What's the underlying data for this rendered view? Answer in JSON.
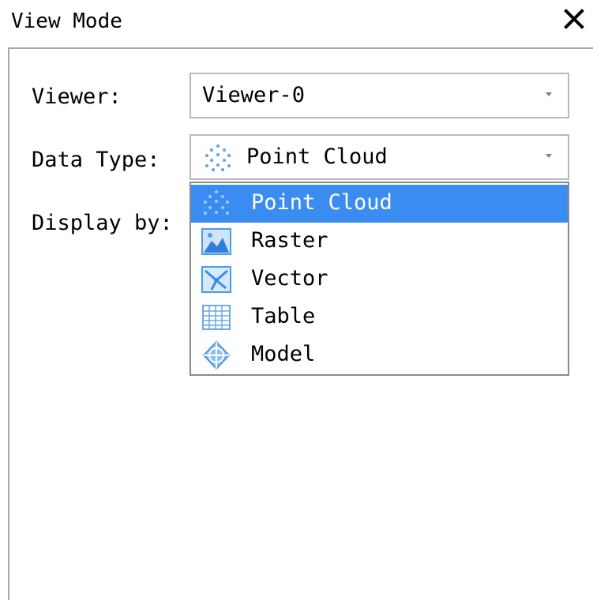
{
  "window": {
    "title": "View Mode",
    "close_glyph": "✕"
  },
  "form": {
    "viewer_label": "Viewer:",
    "viewer_value": "Viewer-0",
    "data_type_label": "Data Type:",
    "data_type_value": "Point Cloud",
    "data_type_icon": "point-cloud-icon",
    "display_by_label": "Display by:"
  },
  "dropdown": {
    "selected_index": 0,
    "items": [
      {
        "label": "Point Cloud",
        "icon": "point-cloud-icon"
      },
      {
        "label": "Raster",
        "icon": "raster-icon"
      },
      {
        "label": "Vector",
        "icon": "vector-icon"
      },
      {
        "label": "Table",
        "icon": "table-icon"
      },
      {
        "label": "Model",
        "icon": "model-icon"
      }
    ]
  },
  "colors": {
    "selection": "#3b8cf0",
    "icon_blue": "#4a9be8"
  }
}
